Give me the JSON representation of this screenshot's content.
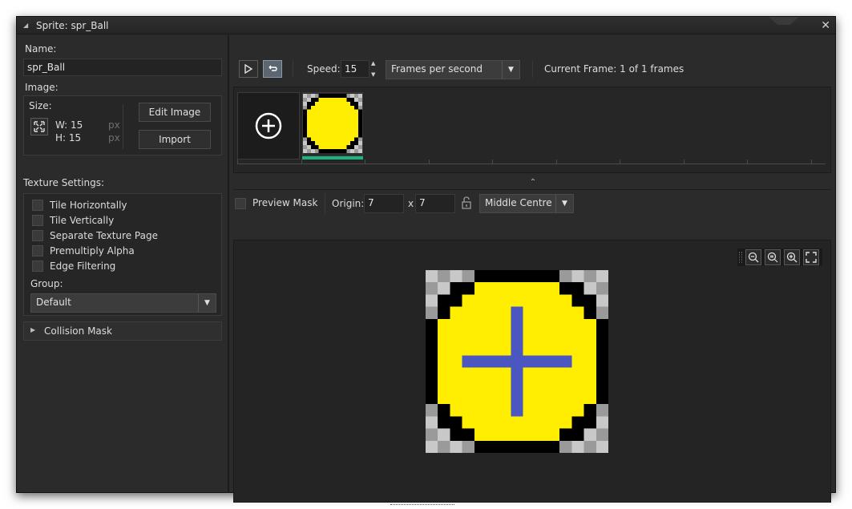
{
  "window": {
    "title": "Sprite: spr_Ball"
  },
  "left": {
    "name_label": "Name:",
    "name_value": "spr_Ball",
    "image_label": "Image:",
    "size_label": "Size:",
    "width_text": "W: 15",
    "height_text": "H: 15",
    "px_unit": "px",
    "edit_image_label": "Edit Image",
    "import_label": "Import",
    "texture_settings_label": "Texture Settings:",
    "checkboxes": [
      {
        "label": "Tile Horizontally",
        "checked": false
      },
      {
        "label": "Tile Vertically",
        "checked": false
      },
      {
        "label": "Separate Texture Page",
        "checked": false
      },
      {
        "label": "Premultiply Alpha",
        "checked": false
      },
      {
        "label": "Edge Filtering",
        "checked": false
      }
    ],
    "group_label": "Group:",
    "group_value": "Default",
    "collision_mask_label": "Collision Mask"
  },
  "toolbar": {
    "speed_label": "Speed:",
    "speed_value": "15",
    "speed_unit": "Frames per second",
    "current_frame": "Current Frame: 1 of 1 frames"
  },
  "mask_bar": {
    "preview_mask_label": "Preview Mask",
    "origin_label": "Origin:",
    "origin_x": "7",
    "origin_sep": "x",
    "origin_y": "7",
    "origin_preset": "Middle Centre"
  },
  "colors": {
    "ball_fill": "#ffee00",
    "outline": "#000000",
    "crosshair": "#4c56c0",
    "frame_selected": "#1db380",
    "checker_light": "#c8c8c8",
    "checker_dark": "#9a9a9a"
  },
  "icons": {
    "collapse": "triangle-down-icon",
    "close": "close-icon",
    "play": "play-icon",
    "loop": "loop-icon",
    "add_frame": "plus-circle-icon",
    "resize": "resize-icon",
    "lock": "lock-icon",
    "zoom_out": "zoom-out-icon",
    "zoom_reset": "zoom-reset-icon",
    "zoom_in": "zoom-in-icon",
    "fullscreen": "fullscreen-icon"
  }
}
